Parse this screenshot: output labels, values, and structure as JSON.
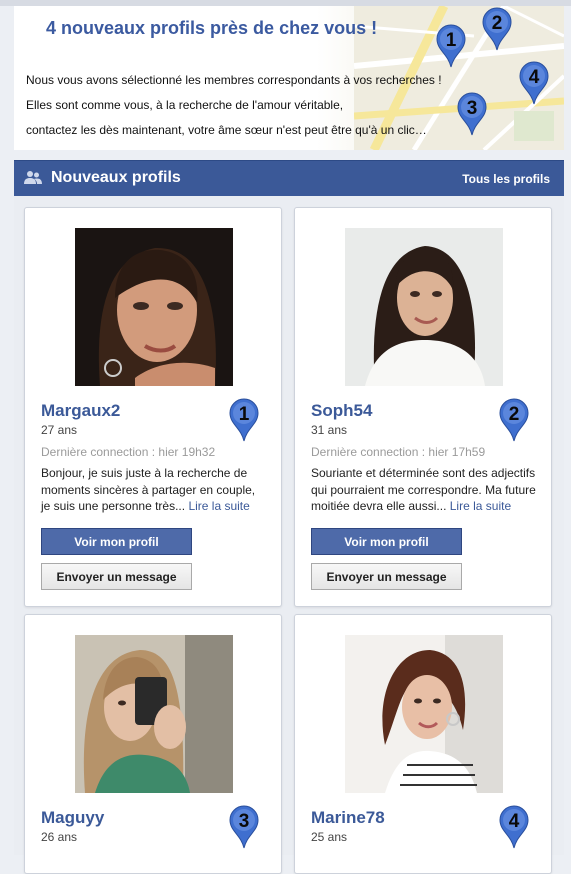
{
  "hero": {
    "title": "4 nouveaux profils près de chez vous !",
    "lines": [
      "Nous vous avons sélectionné les membres correspondants à vos recherches !",
      "Elles sont comme vous, à la recherche de l'amour véritable,",
      "contactez les dès maintenant, votre âme sœur n'est peut être qu'à un clic…"
    ],
    "pins": [
      "1",
      "2",
      "3",
      "4"
    ]
  },
  "section": {
    "title": "Nouveaux profils",
    "all_link": "Tous les profils"
  },
  "profiles": [
    {
      "name": "Margaux2",
      "age": "27 ans",
      "last_label": "Dernière connection :",
      "last_value": "hier 19h32",
      "description": "Bonjour, je suis juste à la recherche de moments sincères à partager en couple, je suis une personne très...",
      "read_more": "Lire la suite",
      "pin": "1",
      "view_label": "Voir mon profil",
      "message_label": "Envoyer un message"
    },
    {
      "name": "Soph54",
      "age": "31 ans",
      "last_label": "Dernière connection :",
      "last_value": "hier 17h59",
      "description": "Souriante et déterminée sont des adjectifs qui pourraient me correspondre. Ma future moitiée devra elle aussi...",
      "read_more": "Lire la suite",
      "pin": "2",
      "view_label": "Voir mon profil",
      "message_label": "Envoyer un message"
    },
    {
      "name": "Maguyy",
      "age": "26 ans",
      "pin": "3"
    },
    {
      "name": "Marine78",
      "age": "25 ans",
      "pin": "4"
    }
  ],
  "colors": {
    "brand": "#3b5998",
    "title": "#3b5aa0",
    "pin": "#3f6fcf",
    "primary_button": "#4e6aa9"
  }
}
